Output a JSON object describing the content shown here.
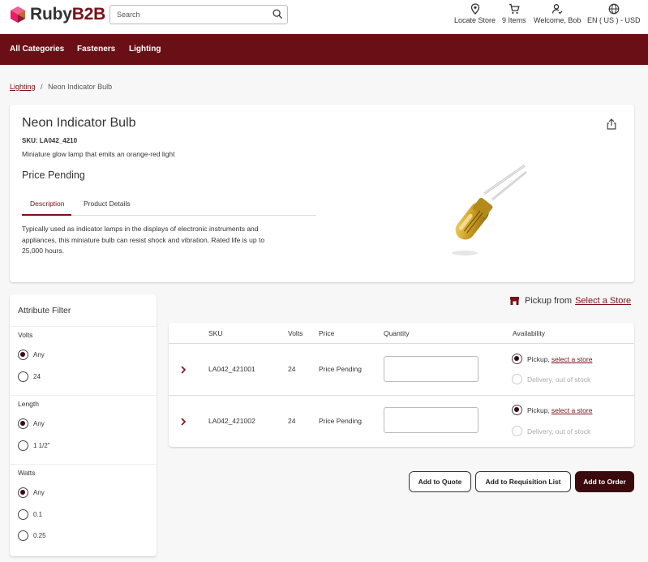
{
  "header": {
    "logo_text_ruby": "Ruby",
    "logo_text_b2b": "B2B",
    "search_placeholder": "Search",
    "locate_store": "Locate Store",
    "cart": "9 Items",
    "welcome": "Welcome, Bob",
    "locale": "EN ( US ) - USD"
  },
  "nav": {
    "items": [
      "All Categories",
      "Fasteners",
      "Lighting"
    ]
  },
  "breadcrumb": {
    "parent": "Lighting",
    "separator": "/",
    "current": "Neon Indicator Bulb"
  },
  "product": {
    "title": "Neon Indicator Bulb",
    "sku": "SKU: LA042_4210",
    "short_description": "Miniature glow lamp that emits an orange-red light",
    "price": "Price Pending",
    "tabs": [
      "Description",
      "Product Details"
    ],
    "description_lines": [
      "Typically used as indicator lamps in the displays of electronic instruments and",
      "appliances, this miniature bulb can resist shock and vibration. Rated life is up to",
      "25,000 hours."
    ]
  },
  "filter": {
    "title": "Attribute Filter",
    "groups": [
      {
        "label": "Volts",
        "options": [
          "Any",
          "24"
        ]
      },
      {
        "label": "Length",
        "options": [
          "Any",
          "1 1/2\""
        ]
      },
      {
        "label": "Watts",
        "options": [
          "Any",
          "0.1",
          "0.25"
        ]
      }
    ]
  },
  "pickup": {
    "label": "Pickup from",
    "link": "Select a Store"
  },
  "table": {
    "columns": [
      "SKU",
      "Volts",
      "Price",
      "Quantity",
      "Availability"
    ],
    "rows": [
      {
        "sku": "LA042_421001",
        "volts": "24",
        "price": "Price Pending",
        "pickup": "Pickup,",
        "pickup_link": "select a store",
        "delivery": "Delivery, out of stock"
      },
      {
        "sku": "LA042_421002",
        "volts": "24",
        "price": "Price Pending",
        "pickup": "Pickup,",
        "pickup_link": "select a store",
        "delivery": "Delivery, out of stock"
      }
    ]
  },
  "actions": {
    "quote": "Add to Quote",
    "requisition": "Add to Requisition List",
    "order": "Add to Order"
  },
  "colors": {
    "brand": "#6b0f16",
    "primary_button": "#3a0a0c"
  }
}
